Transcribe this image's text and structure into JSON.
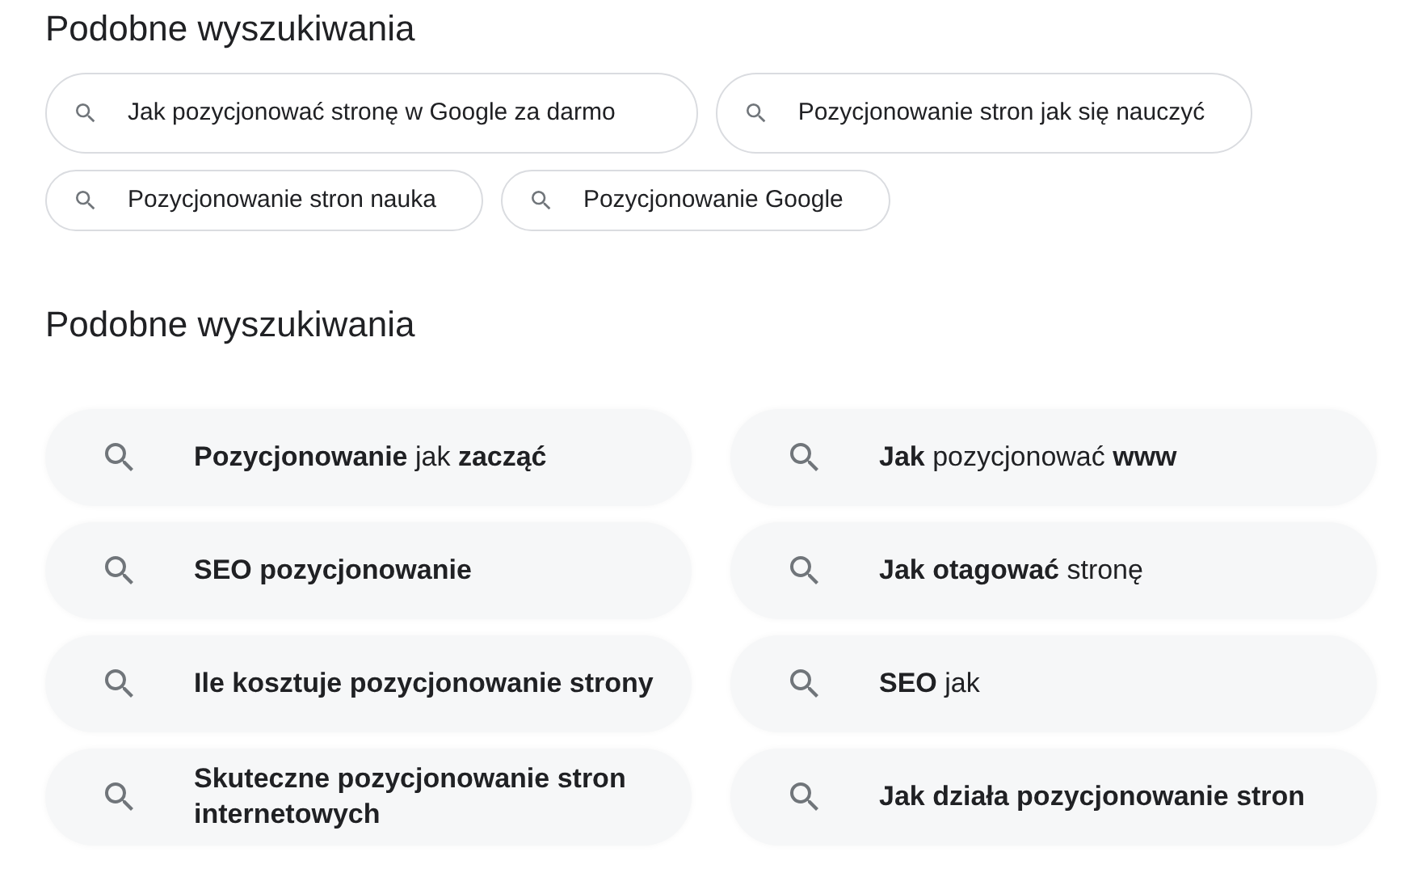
{
  "sections": [
    {
      "title": "Podobne wyszukiwania",
      "kind": "chips",
      "items": [
        {
          "text": "Jak pozycjonować stronę w Google za darmo"
        },
        {
          "text": "Pozycjonowanie stron jak się nauczyć"
        },
        {
          "text": "Pozycjonowanie stron nauka"
        },
        {
          "text": "Pozycjonowanie Google"
        }
      ]
    },
    {
      "title": "Podobne wyszukiwania",
      "kind": "grid",
      "items": [
        {
          "text": "**Pozycjonowanie** jak **zacząć**"
        },
        {
          "text": "**Jak** pozycjonować **www**"
        },
        {
          "text": "**SEO pozycjonowanie**"
        },
        {
          "text": "**Jak otagować** stronę"
        },
        {
          "text": "**Ile kosztuje pozycjonowanie strony**"
        },
        {
          "text": "**SEO** jak"
        },
        {
          "text": "**Skuteczne pozycjonowanie stron internetowych**"
        },
        {
          "text": "**Jak działa pozycjonowanie stron**"
        }
      ]
    }
  ]
}
